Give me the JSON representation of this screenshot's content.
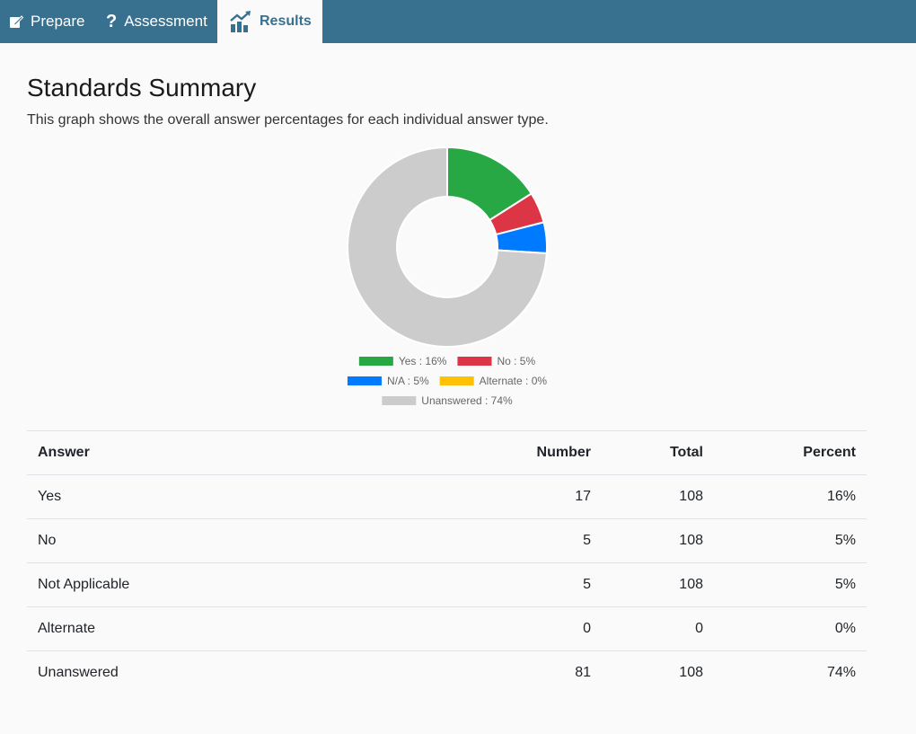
{
  "nav": {
    "tabs": [
      {
        "label": "Prepare",
        "icon": "edit-icon"
      },
      {
        "label": "Assessment",
        "icon": "question-icon"
      },
      {
        "label": "Results",
        "icon": "chart-icon",
        "active": true
      }
    ]
  },
  "page": {
    "title": "Standards Summary",
    "description": "This graph shows the overall answer percentages for each individual answer type."
  },
  "colors": {
    "nav_bg": "#38718f",
    "yes": "#28a745",
    "no": "#dc3545",
    "na": "#007bff",
    "alternate": "#ffc107",
    "unanswered": "#cccccc"
  },
  "chart_data": {
    "type": "pie",
    "donut": true,
    "legend_position": "bottom",
    "slices": [
      {
        "label": "Yes",
        "value": 16,
        "color": "#28a745",
        "legend": "Yes : 16%"
      },
      {
        "label": "No",
        "value": 5,
        "color": "#dc3545",
        "legend": "No : 5%"
      },
      {
        "label": "N/A",
        "value": 5,
        "color": "#007bff",
        "legend": "N/A : 5%"
      },
      {
        "label": "Alternate",
        "value": 0,
        "color": "#ffc107",
        "legend": "Alternate : 0%"
      },
      {
        "label": "Unanswered",
        "value": 74,
        "color": "#cccccc",
        "legend": "Unanswered : 74%"
      }
    ]
  },
  "table": {
    "headers": [
      "Answer",
      "Number",
      "Total",
      "Percent"
    ],
    "rows": [
      [
        "Yes",
        "17",
        "108",
        "16%"
      ],
      [
        "No",
        "5",
        "108",
        "5%"
      ],
      [
        "Not Applicable",
        "5",
        "108",
        "5%"
      ],
      [
        "Alternate",
        "0",
        "0",
        "0%"
      ],
      [
        "Unanswered",
        "81",
        "108",
        "74%"
      ]
    ]
  }
}
